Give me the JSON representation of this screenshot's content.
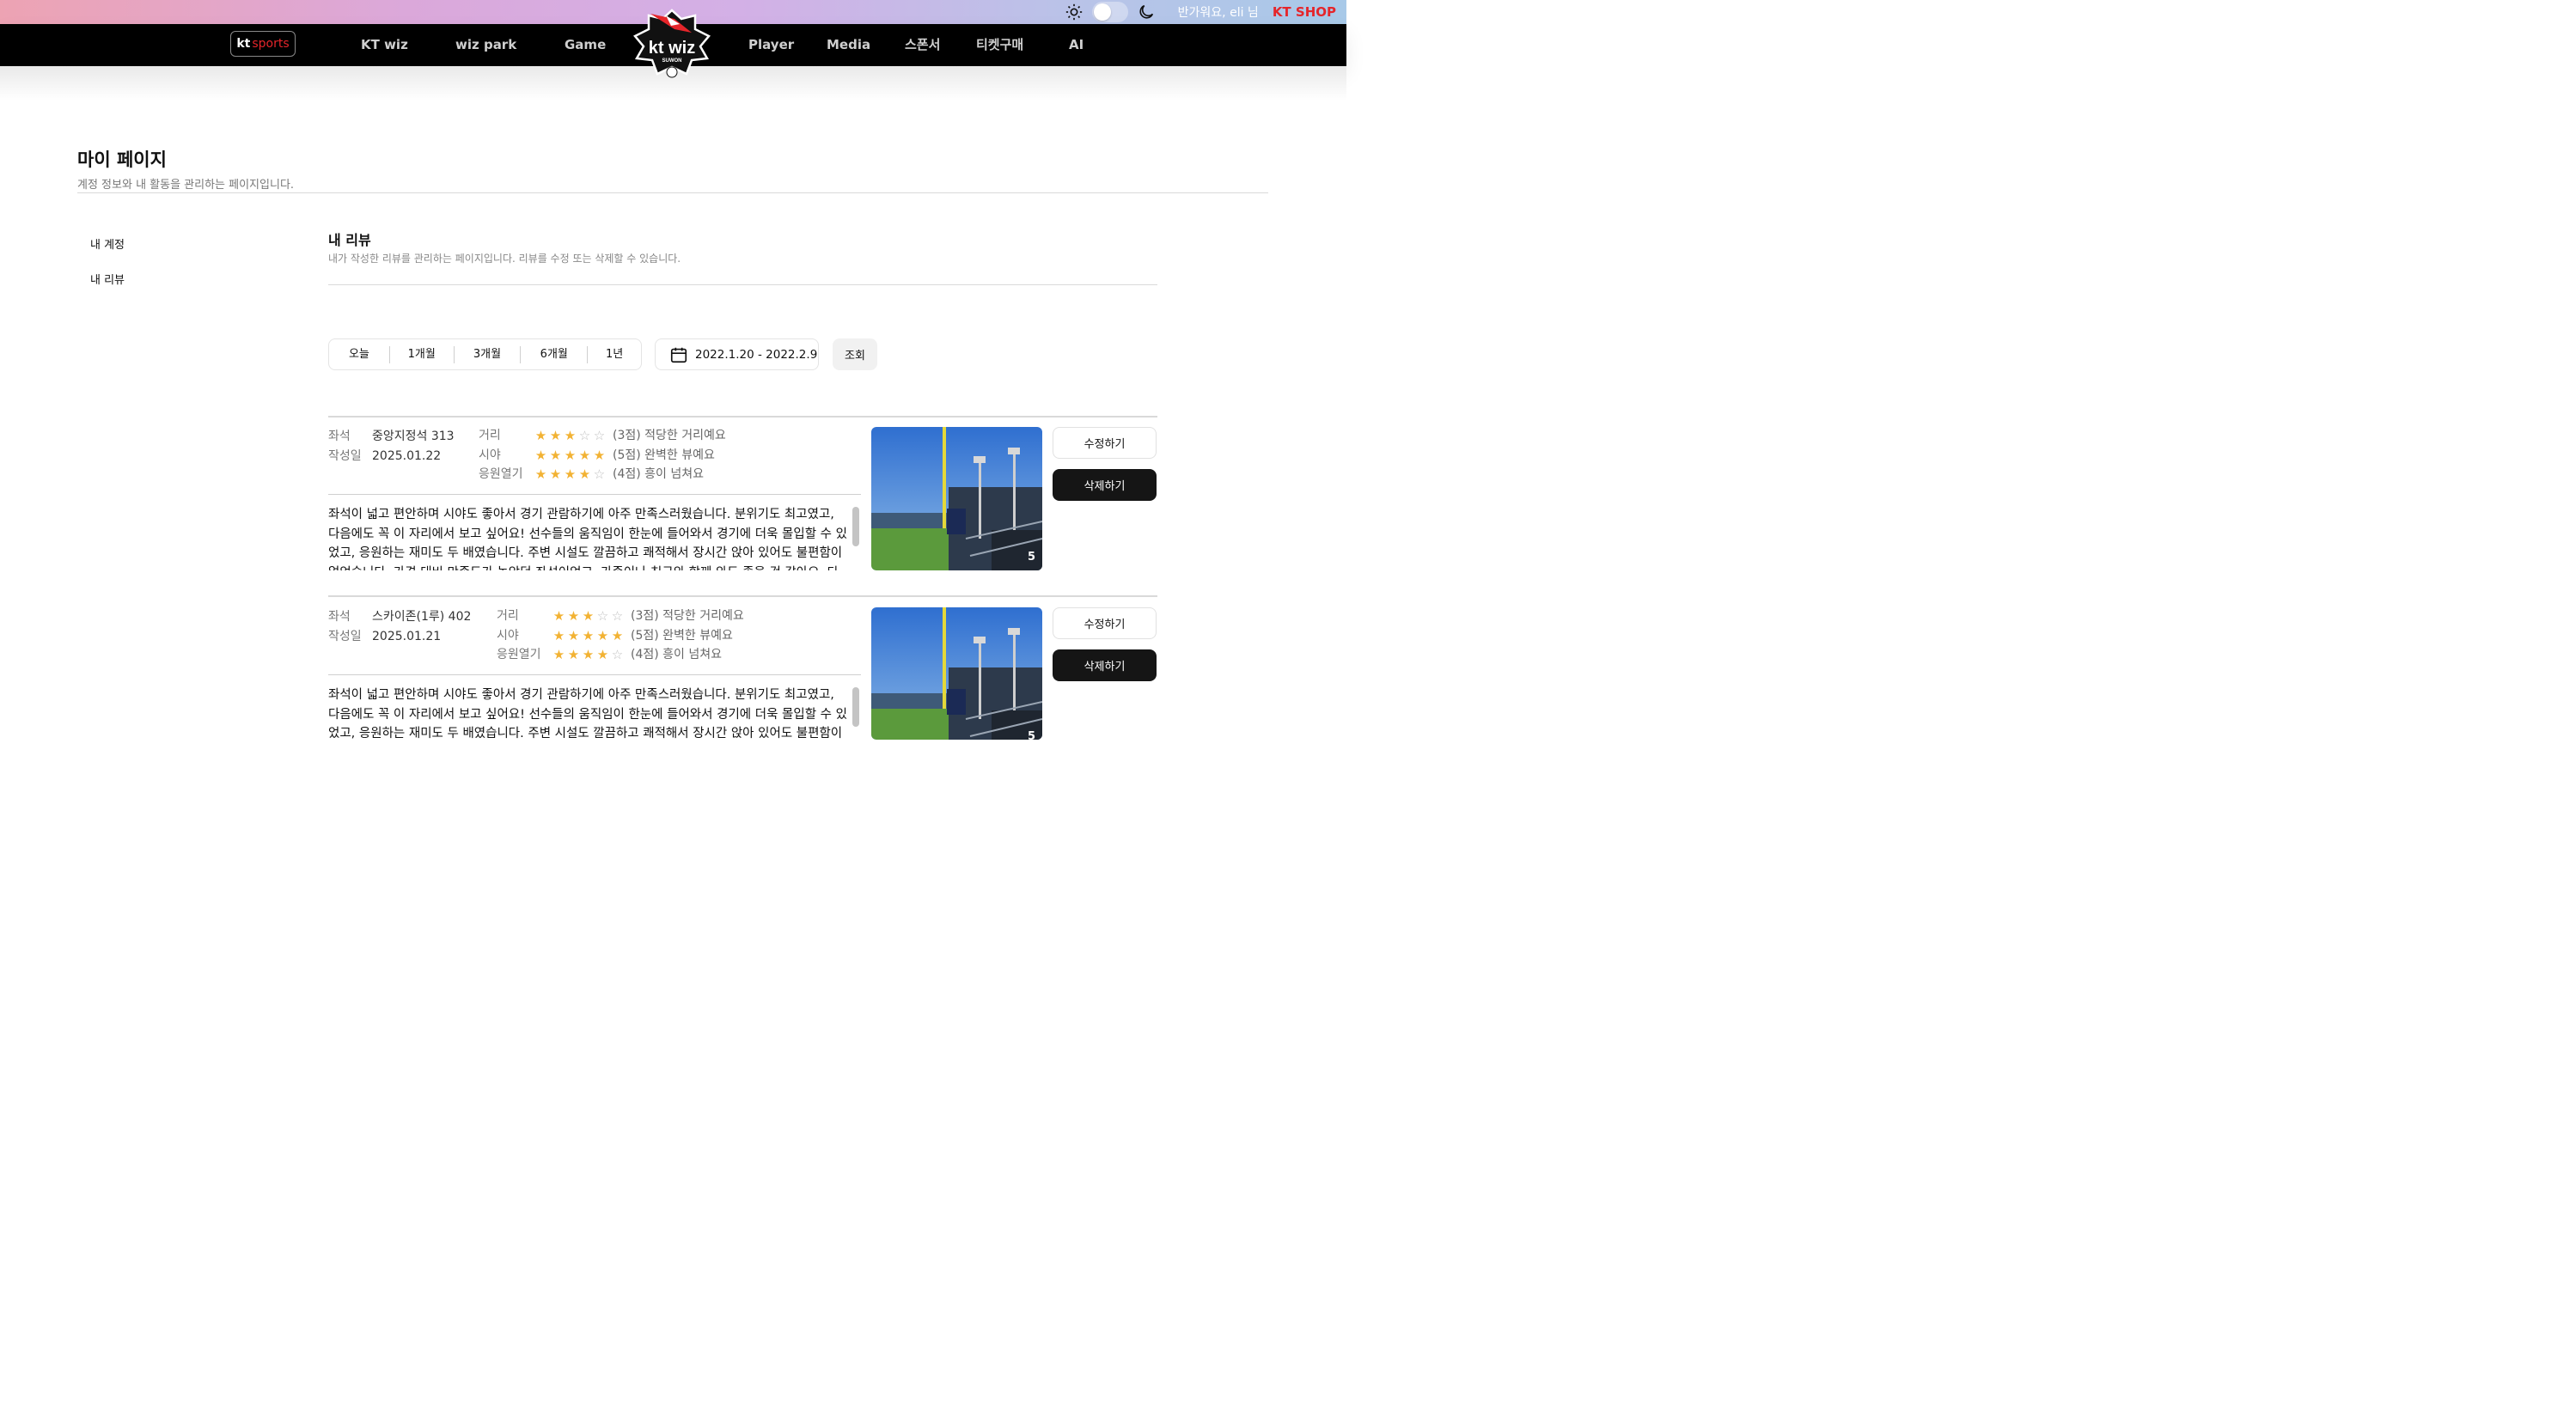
{
  "header": {
    "greeting": "반가워요, eli 님",
    "shop_label": "KT SHOP",
    "brand_kt": "kt",
    "brand_sports": "sports",
    "nav": [
      "KT wiz",
      "wiz park",
      "Game",
      "Player",
      "Media",
      "스폰서",
      "티켓구매",
      "AI"
    ],
    "logo_text": "kt wiz",
    "logo_sub": "SUWON"
  },
  "page": {
    "title": "마이 페이지",
    "subtitle": "계정 정보와 내 활동을 관리하는 페이지입니다."
  },
  "sidebar": {
    "items": [
      {
        "label": "내 계정"
      },
      {
        "label": "내 리뷰"
      }
    ]
  },
  "section": {
    "title": "내 리뷰",
    "subtitle": "내가 작성한 리뷰를 관리하는 페이지입니다. 리뷰를 수정 또는 삭제할 수 있습니다."
  },
  "filters": {
    "periods": [
      "오늘",
      "1개월",
      "3개월",
      "6개월",
      "1년"
    ],
    "date_range": "2022.1.20 - 2022.2.9",
    "search_label": "조회"
  },
  "labels": {
    "seat": "좌석",
    "date": "작성일",
    "distance": "거리",
    "view": "시야",
    "cheer": "응원열기",
    "edit": "수정하기",
    "delete": "삭제하기"
  },
  "reviews": [
    {
      "seat": "중앙지정석 313",
      "date": "2025.01.22",
      "distance_score": 3,
      "distance_text": "(3점) 적당한 거리예요",
      "view_score": 5,
      "view_text": "(5점) 완벽한 뷰예요",
      "cheer_score": 4,
      "cheer_text": "(4점) 흥이 넘쳐요",
      "body": "좌석이 넓고 편안하며 시야도 좋아서 경기 관람하기에 아주 만족스러웠습니다. 분위기도 최고였고, 다음에도 꼭 이 자리에서 보고 싶어요! 선수들의 움직임이 한눈에 들어와서 경기에 더욱 몰입할 수 있었고, 응원하는 재미도 두 배였습니다. 주변 시설도 깔끔하고 쾌적해서 장시간 앉아 있어도 불편함이 없었습니다. 가격 대비 만족도가 높았던 좌석이었고, 가족이나 친구와 함께 와도 좋을 것 같아요. 다음에도 꼭 다시 오고 싶습니다!",
      "photo_count": "5"
    },
    {
      "seat": "스카이존(1루) 402",
      "date": "2025.01.21",
      "distance_score": 3,
      "distance_text": "(3점) 적당한 거리예요",
      "view_score": 5,
      "view_text": "(5점) 완벽한 뷰예요",
      "cheer_score": 4,
      "cheer_text": "(4점) 흥이 넘쳐요",
      "body": "좌석이 넓고 편안하며 시야도 좋아서 경기 관람하기에 아주 만족스러웠습니다. 분위기도 최고였고, 다음에도 꼭 이 자리에서 보고 싶어요! 선수들의 움직임이 한눈에 들어와서 경기에 더욱 몰입할 수 있었고, 응원하는 재미도 두 배였습니다. 주변 시설도 깔끔하고 쾌적해서 장시간 앉아 있어도 불편함이 없었습니다.",
      "photo_count": "5"
    }
  ],
  "colors": {
    "star": "#f2b233",
    "accent_red": "#e5252a",
    "nav_bg": "#000000"
  }
}
